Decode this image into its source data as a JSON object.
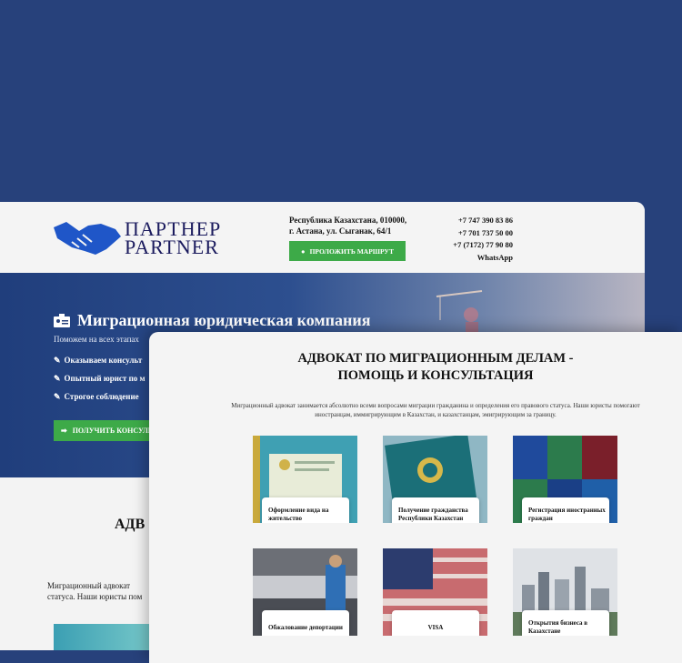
{
  "logo": {
    "line1": "ПАРТНЕР",
    "line2": "PARTNER"
  },
  "header": {
    "address_line1": "Республика Казахстана, 010000,",
    "address_line2": "г. Астана, ул. Сыганак, 64/1",
    "route_button": "ПРОЛОЖИТЬ МАРШРУТ",
    "phones": [
      "+7 747 390 83 86",
      "+7 701 737 50 00",
      "+7 (7172) 77 90 80",
      "WhatsApp"
    ]
  },
  "hero": {
    "title": "Миграционная юридическая компания",
    "subtitle": "Поможем на всех этапах",
    "bullets": [
      "Оказываем консульт",
      "Опытный юрист по м",
      "Строгое соблюдение"
    ],
    "cta": "ПОЛУЧИТЬ КОНСУЛЬ"
  },
  "back_section": {
    "title": "АДВ",
    "desc_line1": "Миграционный адвокат",
    "desc_line2": "статуса. Наши юристы пом"
  },
  "front": {
    "title_line1": "АДВОКАТ ПО МИГРАЦИОННЫМ ДЕЛАМ -",
    "title_line2": "ПОМОЩЬ И КОНСУЛЬТАЦИЯ",
    "desc": "Миграционный адвокат занимается абсолютно всеми вопросами миграции гражданина и определения его правового статуса. Наши юристы помогают иностранцам, иммигрирующим в Казахстан, и казахстанцам, эмигрирующим за границу.",
    "cards": [
      {
        "label": "Оформление вида на жительство"
      },
      {
        "label": "Получение гражданства Республики Казахстан"
      },
      {
        "label": "Регистрация иностранных граждан"
      },
      {
        "label": "Обжалование депортации"
      },
      {
        "label": "VISA"
      },
      {
        "label": "Открытия бизнеса в Казахстане"
      }
    ]
  },
  "colors": {
    "page_bg": "#27417b",
    "accent_green": "#3daa48",
    "logo_blue": "#1f56c8"
  }
}
